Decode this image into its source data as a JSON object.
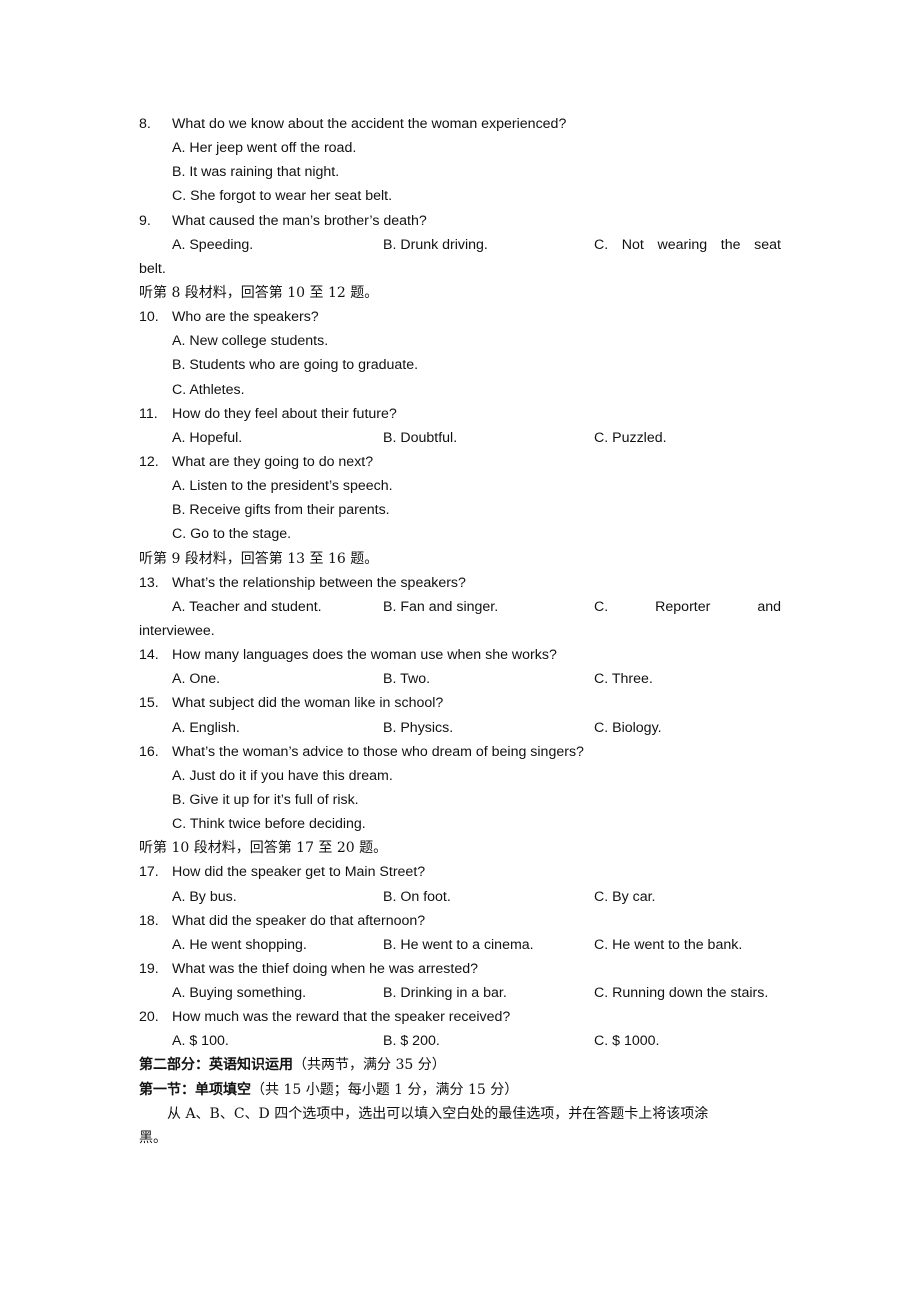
{
  "questions": {
    "q8": {
      "num": "8.",
      "text": "What do we know about the accident the woman experienced?",
      "a": "A. Her jeep went off the road.",
      "b": "B. It was raining that night.",
      "c": "C. She forgot to wear her seat belt."
    },
    "q9": {
      "num": "9.",
      "text": "What caused the man’s brother’s death?",
      "a": "A. Speeding.",
      "b": "B. Drunk driving.",
      "c_words": [
        "C.",
        "Not",
        "wearing",
        "the",
        "seat"
      ],
      "c_wrap": "belt."
    },
    "section8": "听第 8 段材料，回答第 10 至 12 题。",
    "q10": {
      "num": "10.",
      "text": "Who are the speakers?",
      "a": "A. New college students.",
      "b": "B. Students who are going to graduate.",
      "c": "C. Athletes."
    },
    "q11": {
      "num": "11.",
      "text": "How do they feel about their future?",
      "a": "A. Hopeful.",
      "b": "B. Doubtful.",
      "c": "C. Puzzled."
    },
    "q12": {
      "num": "12.",
      "text": "What are they going to do next?",
      "a": "A. Listen to the president’s speech.",
      "b": "B. Receive gifts from their parents.",
      "c": "C. Go to the stage."
    },
    "section9": "听第 9 段材料，回答第 13 至 16 题。",
    "q13": {
      "num": "13.",
      "text": "What’s the relationship between the speakers?",
      "a": "A. Teacher and student.",
      "b": "B. Fan and singer.",
      "c_words": [
        "C.",
        "Reporter",
        "and"
      ],
      "c_wrap": "interviewee."
    },
    "q14": {
      "num": "14.",
      "text": "How many languages does the woman use when she works?",
      "a": "A. One.",
      "b": "B. Two.",
      "c": "C. Three."
    },
    "q15": {
      "num": "15.",
      "text": "What subject did the woman like in school?",
      "a": "A. English.",
      "b": "B. Physics.",
      "c": "C. Biology."
    },
    "q16": {
      "num": "16.",
      "text": "What’s the woman’s advice to those who dream of being singers?",
      "a": "A. Just do it if you have this dream.",
      "b": "B. Give it up for it’s full of risk.",
      "c": "C. Think twice before deciding."
    },
    "section10": "听第 10 段材料，回答第 17 至 20 题。",
    "q17": {
      "num": "17.",
      "text": "How did the speaker get to Main Street?",
      "a": "A. By bus.",
      "b": "B. On foot.",
      "c": "C. By car."
    },
    "q18": {
      "num": "18.",
      "text": "What did the speaker do that afternoon?",
      "a": "A. He went shopping.",
      "b": "B. He went to a cinema.",
      "c": "C. He went to the bank."
    },
    "q19": {
      "num": "19.",
      "text": "What was the thief doing when he was arrested?",
      "a": "A. Buying something.",
      "b": "B. Drinking in a bar.",
      "c": "C. Running down the stairs."
    },
    "q20": {
      "num": "20.",
      "text": "How much was the reward that the speaker received?",
      "a": "A. $ 100.",
      "b": "B. $ 200.",
      "c": "C. $ 1000."
    }
  },
  "part2": {
    "heading_bold": "第二部分：英语知识运用",
    "heading_note": "（共两节，满分 35 分）",
    "section1_bold": "第一节：单项填空",
    "section1_note": "（共 15 小题；每小题 1 分，满分 15 分）",
    "instruction_line1": "从 A、B、C、D 四个选项中，选出可以填入空白处的最佳选项，并在答题卡上将该项涂",
    "instruction_line2": "黑。"
  }
}
